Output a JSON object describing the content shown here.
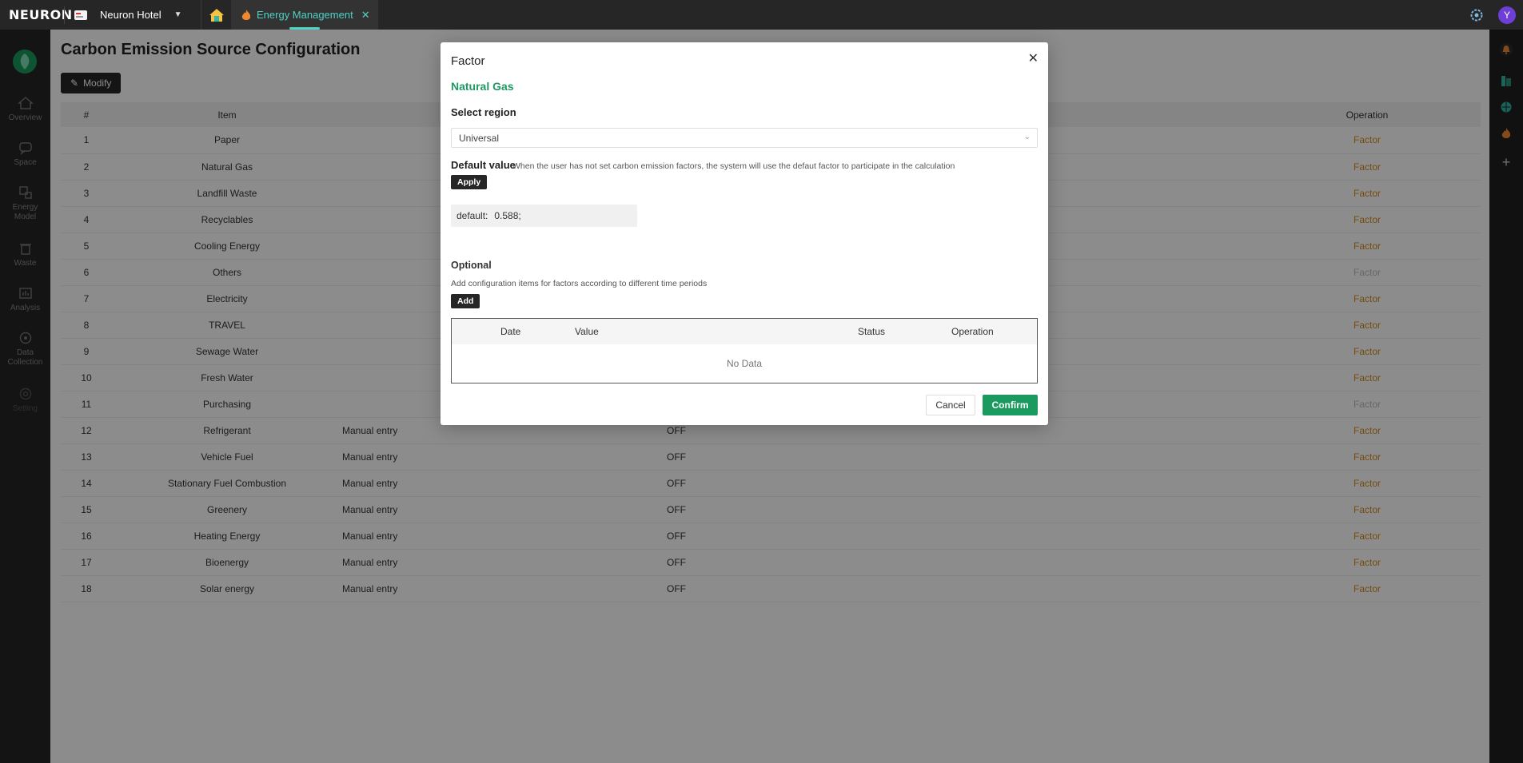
{
  "topbar": {
    "logo": "NEURON",
    "hotel_name": "Neuron Hotel",
    "active_tab_label": "Energy Management",
    "avatar_letter": "Y"
  },
  "sidebar": {
    "items": [
      {
        "label": "Overview",
        "icon": "home-icon"
      },
      {
        "label": "Space",
        "icon": "chat-icon"
      },
      {
        "label": "Energy Model",
        "icon": "model-icon"
      },
      {
        "label": "Waste",
        "icon": "trash-icon"
      },
      {
        "label": "Analysis",
        "icon": "chart-icon"
      },
      {
        "label": "Data Collection",
        "icon": "data-icon"
      },
      {
        "label": "Setting",
        "icon": "gear-icon"
      }
    ]
  },
  "page": {
    "title": "Carbon Emission Source Configuration",
    "modify_label": "Modify"
  },
  "table": {
    "headers": {
      "num": "#",
      "item": "Item",
      "operation": "Operation"
    },
    "rows": [
      {
        "num": "1",
        "item": "Paper",
        "type": "",
        "status": "",
        "op": "Factor"
      },
      {
        "num": "2",
        "item": "Natural Gas",
        "type": "",
        "status": "",
        "op": "Factor"
      },
      {
        "num": "3",
        "item": "Landfill Waste",
        "type": "",
        "status": "",
        "op": "Factor"
      },
      {
        "num": "4",
        "item": "Recyclables",
        "type": "",
        "status": "",
        "op": "Factor"
      },
      {
        "num": "5",
        "item": "Cooling Energy",
        "type": "",
        "status": "",
        "op": "Factor"
      },
      {
        "num": "6",
        "item": "Others",
        "type": "",
        "status": "",
        "op": "Factor"
      },
      {
        "num": "7",
        "item": "Electricity",
        "type": "",
        "status": "",
        "op": "Factor"
      },
      {
        "num": "8",
        "item": "TRAVEL",
        "type": "",
        "status": "",
        "op": "Factor"
      },
      {
        "num": "9",
        "item": "Sewage Water",
        "type": "",
        "status": "",
        "op": "Factor"
      },
      {
        "num": "10",
        "item": "Fresh Water",
        "type": "",
        "status": "",
        "op": "Factor"
      },
      {
        "num": "11",
        "item": "Purchasing",
        "type": "",
        "status": "",
        "op": "Factor"
      },
      {
        "num": "12",
        "item": "Refrigerant",
        "type": "Manual entry",
        "status": "OFF",
        "op": "Factor"
      },
      {
        "num": "13",
        "item": "Vehicle Fuel",
        "type": "Manual entry",
        "status": "OFF",
        "op": "Factor"
      },
      {
        "num": "14",
        "item": "Stationary Fuel Combustion",
        "type": "Manual entry",
        "status": "OFF",
        "op": "Factor"
      },
      {
        "num": "15",
        "item": "Greenery",
        "type": "Manual entry",
        "status": "OFF",
        "op": "Factor"
      },
      {
        "num": "16",
        "item": "Heating Energy",
        "type": "Manual entry",
        "status": "OFF",
        "op": "Factor"
      },
      {
        "num": "17",
        "item": "Bioenergy",
        "type": "Manual entry",
        "status": "OFF",
        "op": "Factor"
      },
      {
        "num": "18",
        "item": "Solar energy",
        "type": "Manual entry",
        "status": "OFF",
        "op": "Factor"
      }
    ]
  },
  "modal": {
    "title": "Factor",
    "subtitle": "Natural Gas",
    "region_label": "Select region",
    "region_value": "Universal",
    "default_label": "Default value",
    "default_note": "When the user has not set carbon emission factors, the system will use the defaut factor to participate in the calculation",
    "apply_label": "Apply",
    "default_key": "default:",
    "default_val": "0.588;",
    "optional_label": "Optional",
    "optional_desc": "Add configuration items for factors according to different time periods",
    "add_label": "Add",
    "table_headers": {
      "date": "Date",
      "value": "Value",
      "status": "Status",
      "operation": "Operation"
    },
    "no_data": "No Data",
    "cancel_label": "Cancel",
    "confirm_label": "Confirm"
  },
  "colors": {
    "accent": "#1a9a5e",
    "tab_active": "#4fd1c5",
    "factor_link": "#d68a1a",
    "dark": "#262626"
  }
}
